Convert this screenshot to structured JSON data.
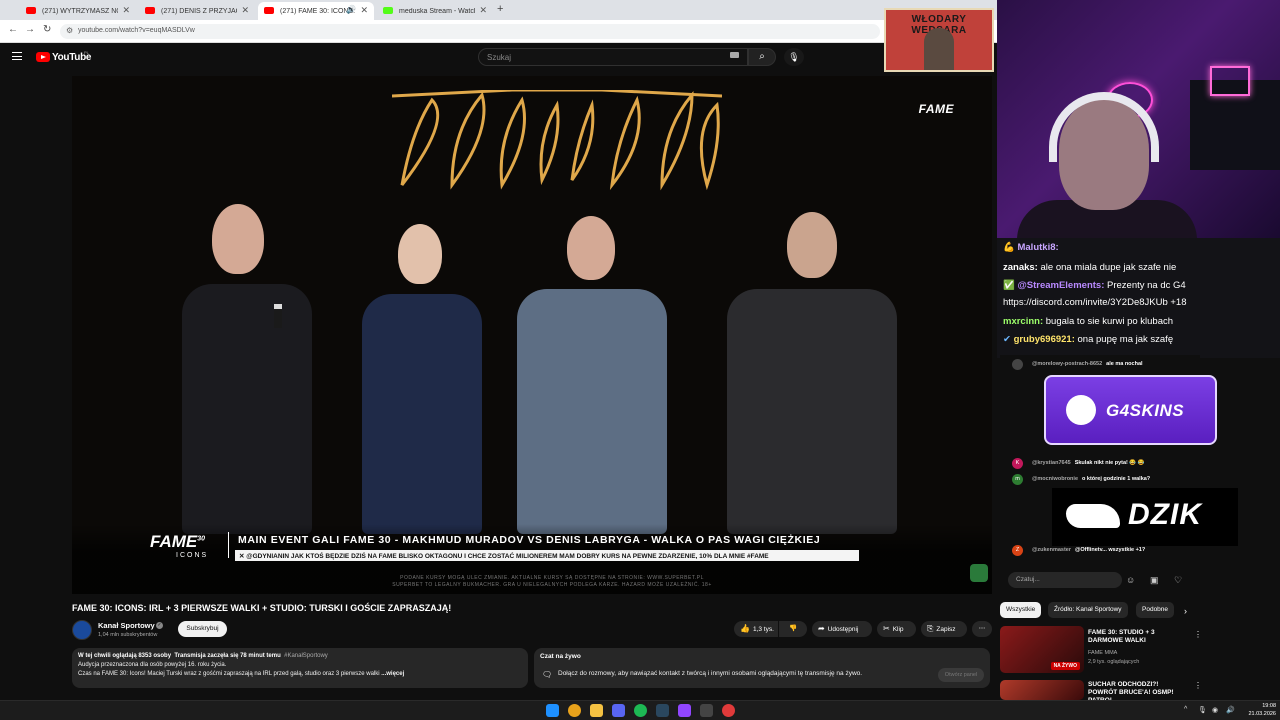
{
  "browser": {
    "tabs": [
      {
        "label": "(271) WYTRZYMASZ NOC W T...",
        "favicon": "youtube-favicon",
        "active": false
      },
      {
        "label": "(271) DENIS Z PRZYJACIELEM ...",
        "favicon": "youtube-favicon",
        "active": false
      },
      {
        "label": "(271) FAME 30: ICONS: IRL",
        "favicon": "youtube-favicon",
        "active": true
      },
      {
        "label": "meduska Stream - Watch Live...",
        "favicon": "kick-favicon",
        "active": false
      }
    ],
    "url": "youtube.com/watch?v=euqMASDLVw"
  },
  "youtube_header": {
    "wordmark": "YouTube",
    "region": "PL",
    "search_placeholder": "Szukaj"
  },
  "video": {
    "brand_logo": "FAME",
    "event_logo": "FAME",
    "event_logo_number": "30",
    "event_sub": "ICONS",
    "headline": "MAIN EVENT GALI FAME 30 - MAKHMUD MURADOV VS DENIS LABRYGA - WALKA O PAS WAGI CIĘŻKIEJ",
    "ticker": "✕ @GDYNIANIN JAK KTOŚ BĘDZIE DZIŚ NA FAME BLISKO OKTAGONU I CHCE ZOSTAĆ MILIONEREM MAM DOBRY KURS NA PEWNE ZDARZENIE, 10% DLA MNIE  #FAME",
    "disclaimer_line1": "PODANE KURSY MOGĄ ULEC ZMIANIE. AKTUALNE KURSY SĄ DOSTĘPNE NA STRONIE: WWW.SUPERBET.PL",
    "disclaimer_line2": "SUPERBET TO LEGALNY BUKMACHER. GRA U NIELEGALNYCH PODLEGA KARZE. HAZARD MOŻE UZALEŻNIĆ. 18+"
  },
  "watch": {
    "title": "FAME 30: ICONS: IRL + 3 PIERWSZE WALKI + STUDIO: TURSKI I GOŚCIE ZAPRASZAJĄ!",
    "channel_name": "Kanał Sportowy",
    "subscribers": "1,04 mln subskrybentów",
    "subscribe_label": "Subskrybuj",
    "like_count": "1,3 tys.",
    "share_label": "Udostępnij",
    "clip_label": "Klip",
    "save_label": "Zapisz",
    "description": {
      "watching": "W tej chwili oglądają 8353 osoby",
      "started": "Transmisja zaczęła się 78 minut temu",
      "hashtag": "#KanałSportowy",
      "line2": "Audycja przeznaczona dla osób powyżej 16. roku życia.",
      "line3": "Czas na FAME 30: Icons! Maciej Turski wraz z gośćmi zapraszają na IRL przed galą, studio oraz 3 pierwsze walki",
      "more": "...więcej"
    },
    "live_chat_box": {
      "title": "Czat na żywo",
      "text": "Dołącz do rozmowy, aby nawiązać kontakt z twórcą i innymi osobami oglądającymi tę transmisję na żywo.",
      "open_panel": "Otwórz panel"
    }
  },
  "stream_overlay": {
    "poster_text": "WŁODARY WEDSARA",
    "chat": [
      {
        "user": "Malutki8:",
        "message": "",
        "color": "#c8a6ff",
        "badge": "💪"
      },
      {
        "user": "zanaks:",
        "message": "ale ona miala dupe jak szafe nie",
        "color": "#ffffff",
        "badge": ""
      },
      {
        "user": "@StreamElements:",
        "message": "Prezenty na dc G4",
        "color": "#b98aff",
        "badge": "✅"
      },
      {
        "user": "",
        "message": "https://discord.com/invite/3Y2De8JKUb +18",
        "color": "#ffffff",
        "badge": ""
      },
      {
        "user": "mxrcinn:",
        "message": "bugala to sie kurwi po klubach",
        "color": "#9dff6b",
        "badge": ""
      },
      {
        "user": "gruby696921:",
        "message": "ona pupę ma jak szafę",
        "color": "#ffe46b",
        "badge": "✔"
      }
    ],
    "sponsor_1": "G4SKINS",
    "sponsor_2": "DZIK"
  },
  "youtube_chat": {
    "messages": [
      {
        "name": "@morelowy-postrach-8652",
        "message": "ale ma nochal",
        "avatar": "",
        "color": "#444"
      },
      {
        "name": "@krystian7645",
        "message": "Skulak nikt nie pyta! 😂 😂",
        "avatar": "K",
        "color": "#c2185b"
      },
      {
        "name": "@mocniwobronie",
        "message": "o której godzinie 1 walka?",
        "avatar": "m",
        "color": "#2e7d32"
      },
      {
        "name": "@zukenmaster",
        "message": "@Offlinetv... wszystkie +1?",
        "avatar": "Z",
        "color": "#d84315"
      }
    ],
    "input_placeholder": "Czatuj..."
  },
  "related": {
    "chips": [
      "Wszystkie",
      "Źródło: Kanał Sportowy",
      "Podobne"
    ],
    "videos": [
      {
        "title": "FAME 30: STUDIO + 3 DARMOWE WALKI",
        "channel": "FAME MMA",
        "meta": "2,9 tys. oglądających",
        "badge": "NA ŻYWO"
      },
      {
        "title": "SUCHAR ODCHODZI?! POWRÓT BRUCE'A! OSMP! PATRO!",
        "channel": "",
        "meta": "",
        "badge": ""
      }
    ]
  },
  "taskbar": {
    "time": "19:08",
    "date": "21.03.2026"
  }
}
